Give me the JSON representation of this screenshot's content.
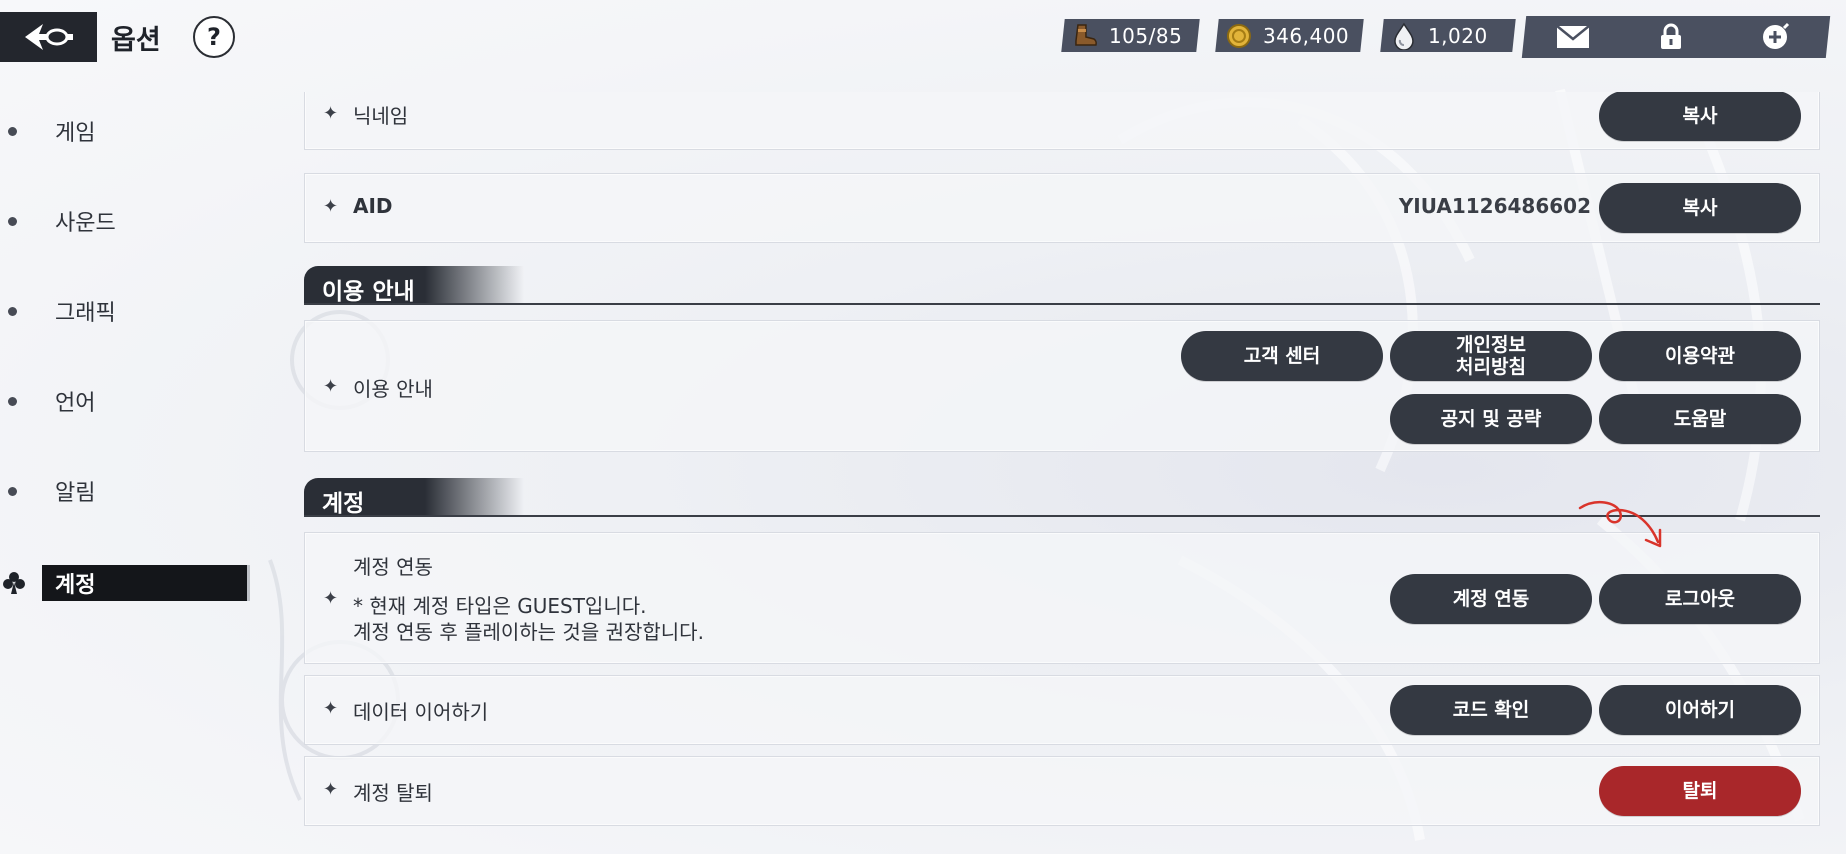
{
  "header": {
    "title": "옵션",
    "help_label": "?",
    "resources": [
      {
        "icon": "boot-icon",
        "value": "105/85"
      },
      {
        "icon": "gold-coin-icon",
        "value": "346,400"
      },
      {
        "icon": "crystal-drop-icon",
        "value": "1,020"
      }
    ],
    "quick_buttons": [
      "mail-icon",
      "lock-icon",
      "add-circle-icon"
    ]
  },
  "sidebar": {
    "items": [
      {
        "label": "게임"
      },
      {
        "label": "사운드"
      },
      {
        "label": "그래픽"
      },
      {
        "label": "언어"
      },
      {
        "label": "알림"
      },
      {
        "label": "계정"
      }
    ],
    "active_index": 5
  },
  "rows": {
    "nickname": {
      "label": "닉네임",
      "button": "복사"
    },
    "aid": {
      "label": "AID",
      "value": "YIUA1126486602",
      "button": "복사"
    }
  },
  "usage": {
    "section_title": "이용 안내",
    "row_label": "이용 안내",
    "buttons": {
      "support": "고객 센터",
      "privacy_line1": "개인정보",
      "privacy_line2": "처리방침",
      "terms": "이용약관",
      "notice": "공지 및 공략",
      "help": "도움말"
    }
  },
  "account": {
    "section_title": "계정",
    "link_title": "계정 연동",
    "link_desc1": "* 현재 계정 타입은 GUEST입니다.",
    "link_desc2": "계정 연동 후 플레이하는 것을 권장합니다.",
    "link_button": "계정 연동",
    "logout_button": "로그아웃",
    "data_label": "데이터 이어하기",
    "code_button": "코드 확인",
    "continue_button": "이어하기",
    "withdraw_label": "계정 탈퇴",
    "withdraw_button": "탈퇴"
  },
  "colors": {
    "button_dark": "#343942",
    "button_danger": "#a9272a",
    "annotation_red": "#d9342b",
    "resource_bg": "#4a5060"
  }
}
